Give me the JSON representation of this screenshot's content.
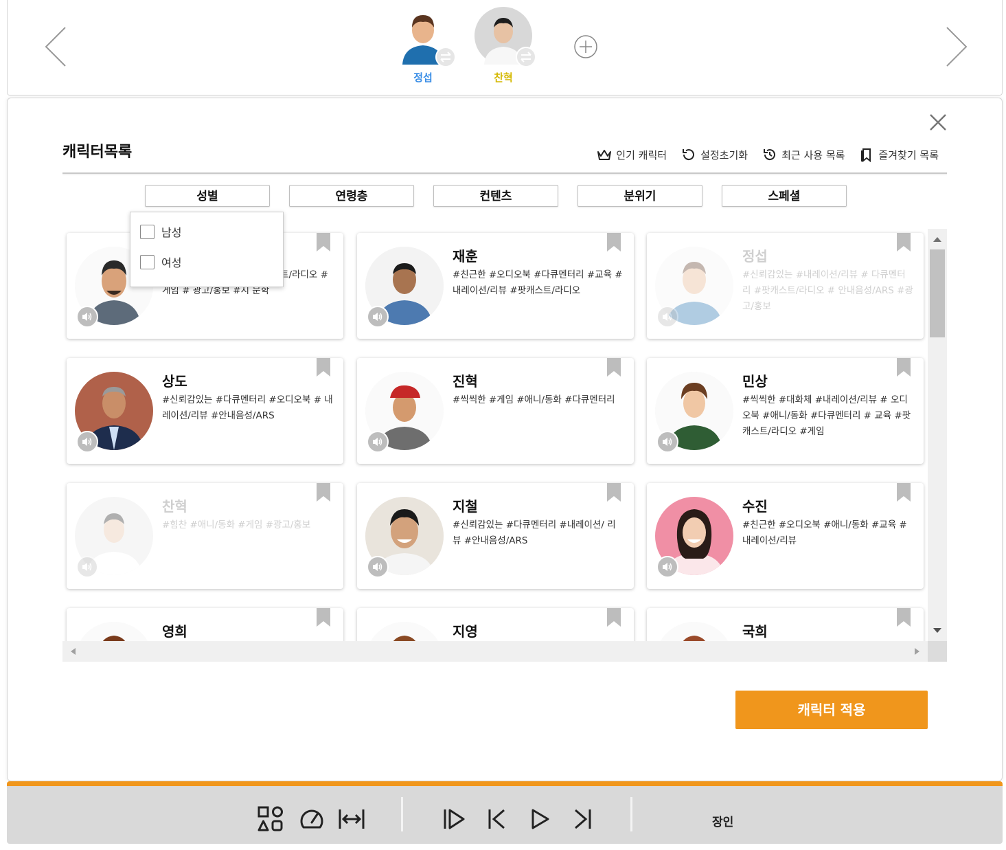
{
  "voices": [
    {
      "name": "정섭",
      "color": "#3a8ee6"
    },
    {
      "name": "찬혁",
      "color": "#d4b800"
    }
  ],
  "panel": {
    "title": "캐릭터목록",
    "toolbar": {
      "popular": "인기 캐릭터",
      "reset": "설정초기화",
      "recent": "최근 사용 목록",
      "favorites": "즐겨찾기 목록"
    },
    "filters": [
      "성별",
      "연령층",
      "컨텐츠",
      "분위기",
      "스페셜"
    ],
    "gender_options": [
      "남성",
      "여성"
    ],
    "apply_label": "캐릭터 적용"
  },
  "characters": [
    {
      "name": "",
      "tags": "디오북 # 다큐멘터리 #팟캐스트/라디오 #게임 # 광고/홍보 #시 문학",
      "dim": false
    },
    {
      "name": "재훈",
      "tags": "#친근한 #오디오북 #다큐멘터리 #교육 #내레이션/리뷰 #팟캐스트/라디오",
      "dim": false
    },
    {
      "name": "정섭",
      "tags": "#신뢰감있는 #내레이션/리뷰 # 다큐멘터리 #팟캐스트/라디오 # 안내음성/ARS #광고/홍보",
      "dim": true
    },
    {
      "name": "상도",
      "tags": "#신뢰감있는 #다큐멘터리 #오디오북 # 내레이션/리뷰 #안내음성/ARS",
      "dim": false
    },
    {
      "name": "진혁",
      "tags": "#씩씩한 #게임 #애니/동화 #다큐멘터리",
      "dim": false
    },
    {
      "name": "민상",
      "tags": "#씩씩한 #대화체 #내레이션/리뷰 # 오디오북 #애니/동화 #다큐멘터리 # 교육 #팟캐스트/라디오 #게임",
      "dim": false
    },
    {
      "name": "찬혁",
      "tags": "#힘찬 #애니/동화 #게임 #광고/홍보",
      "dim": true
    },
    {
      "name": "지철",
      "tags": "#신뢰감있는 #다큐멘터리 #내레이션/ 리뷰 #안내음성/ARS",
      "dim": false
    },
    {
      "name": "수진",
      "tags": "#친근한 #오디오북 #애니/동화 #교육 # 내레이션/리뷰",
      "dim": false
    },
    {
      "name": "영희",
      "tags": "",
      "dim": false
    },
    {
      "name": "지영",
      "tags": "",
      "dim": false
    },
    {
      "name": "국희",
      "tags": "",
      "dim": false
    }
  ],
  "player": {
    "speaker": "장인"
  },
  "colors": {
    "accent": "#f0961c",
    "voice1": "#3a8ee6",
    "voice2": "#d4b800"
  }
}
